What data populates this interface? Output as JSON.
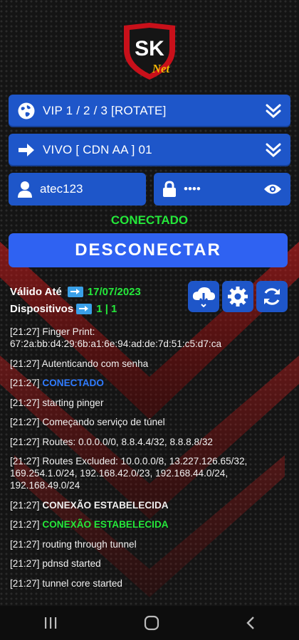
{
  "logo": {
    "brand_letters": "SK",
    "brand_sub": "Net"
  },
  "server_select": {
    "label": "VIP 1 / 2 / 3 [ROTATE]",
    "icon": "globe-icon"
  },
  "mode_select": {
    "label": "VIVO [ CDN AA ] 01",
    "icon": "arrow-right-icon"
  },
  "username": {
    "value": "atec123"
  },
  "password": {
    "value": "••••"
  },
  "status": "CONECTADO",
  "connect_button": "DESCONECTAR",
  "validity": {
    "label": "Válido Até",
    "date": "17/07/2023"
  },
  "devices": {
    "label": "Dispositivos",
    "count": "1 | 1"
  },
  "colors": {
    "primary": "#1e56c9",
    "button": "#2f62f2",
    "green": "#24e83a",
    "log_blue": "#2f7bff",
    "accent_red": "#d0101a"
  },
  "logs": [
    {
      "time": "[21:27]",
      "text": "Finger Print: 67:2a:bb:d4:29:6b:a1:6e:94:ad:de:7d:51:c5:d7:ca",
      "style": ""
    },
    {
      "time": "[21:27]",
      "text": "Autenticando com senha",
      "style": ""
    },
    {
      "time": "[21:27]",
      "text": "CONECTADO",
      "style": "blue"
    },
    {
      "time": "[21:27]",
      "text": "starting pinger",
      "style": ""
    },
    {
      "time": "[21:27]",
      "text": "Começando serviço de túnel",
      "style": ""
    },
    {
      "time": "[21:27]",
      "text": "Routes: 0.0.0.0/0, 8.8.4.4/32, 8.8.8.8/32",
      "style": ""
    },
    {
      "time": "[21:27]",
      "text": "Routes Excluded: 10.0.0.0/8, 13.227.126.65/32, 169.254.1.0/24, 192.168.42.0/23, 192.168.44.0/24, 192.168.49.0/24",
      "style": ""
    },
    {
      "time": "[21:27]",
      "text": "CONEXÃO ESTABELECIDA",
      "style": "bold"
    },
    {
      "time": "[21:27]",
      "text": "CONEXÃO ESTABELECIDA",
      "style": "green"
    },
    {
      "time": "[21:27]",
      "text": "routing through tunnel",
      "style": ""
    },
    {
      "time": "[21:27]",
      "text": "pdnsd started",
      "style": ""
    },
    {
      "time": "[21:27]",
      "text": "tunnel core started",
      "style": ""
    }
  ]
}
